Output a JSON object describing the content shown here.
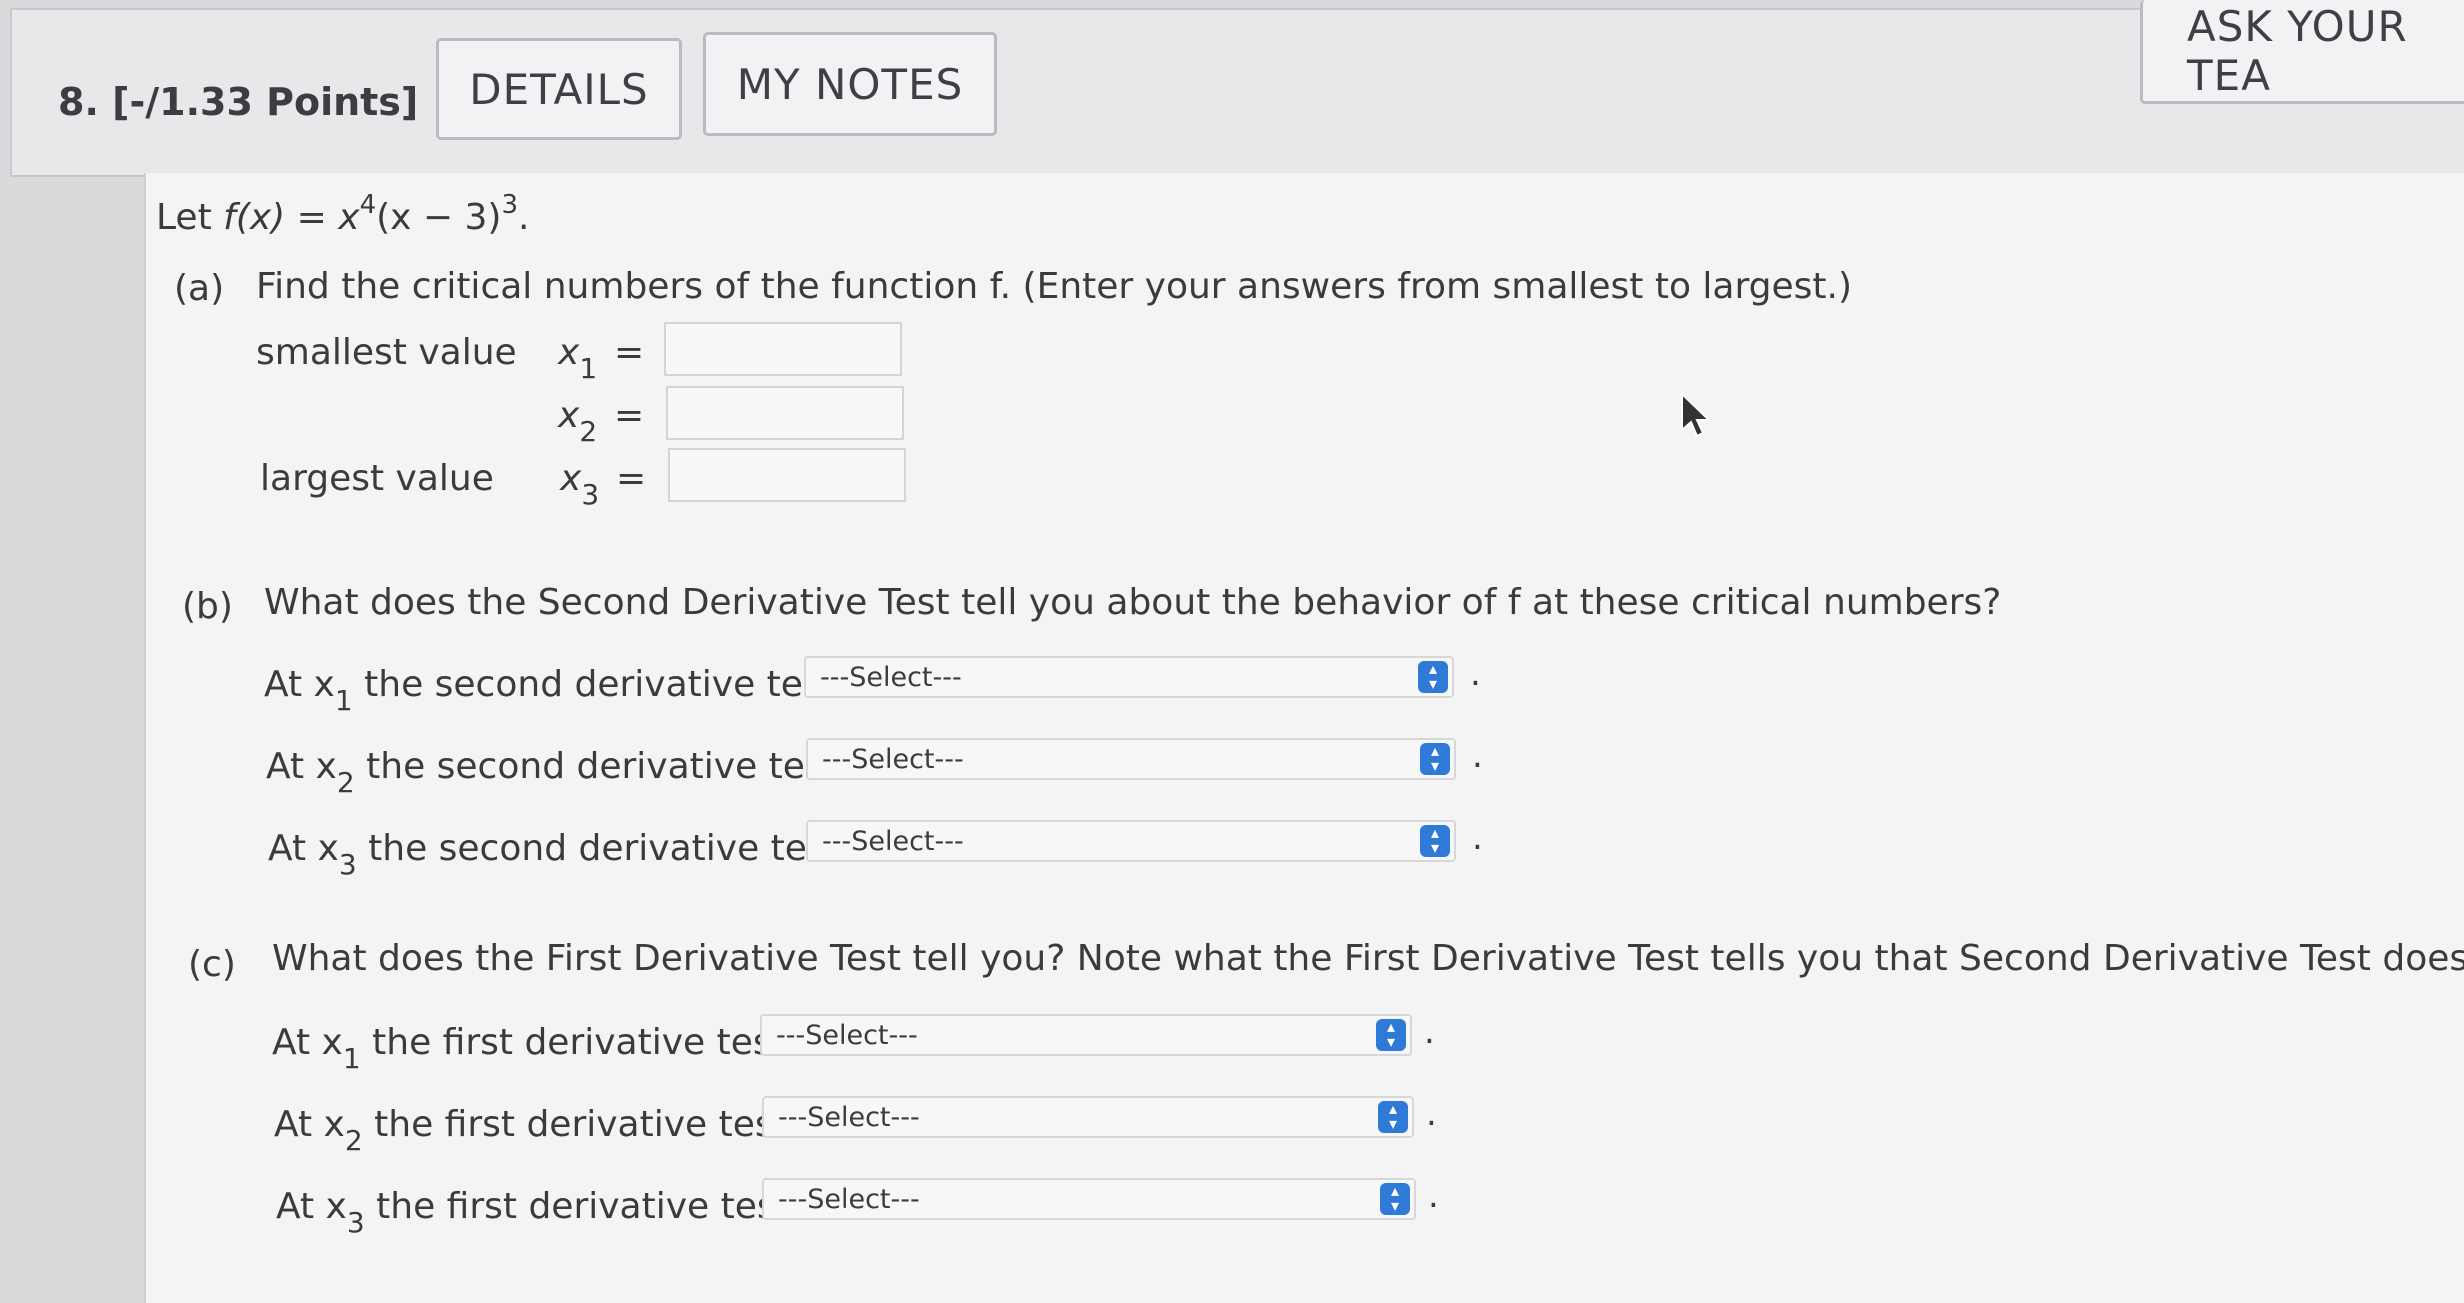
{
  "header": {
    "question_number": "8. [-/1.33 Points]",
    "details_label": "DETAILS",
    "notes_label": "MY NOTES",
    "ask_label": "ASK YOUR TEA"
  },
  "problem": {
    "intro_prefix": "Let ",
    "intro_func": "f(x) = x",
    "intro_exp1": "4",
    "intro_mid": "(x − 3)",
    "intro_exp2": "3",
    "intro_end": "."
  },
  "part_a": {
    "label": "(a)",
    "question": "Find the critical numbers of the function f. (Enter your answers from smallest to largest.)",
    "rows": [
      {
        "tag": "smallest value",
        "var": "x",
        "sub": "1",
        "eq": "=",
        "value": ""
      },
      {
        "tag": "",
        "var": "x",
        "sub": "2",
        "eq": "=",
        "value": ""
      },
      {
        "tag": "largest value",
        "var": "x",
        "sub": "3",
        "eq": "=",
        "value": ""
      }
    ]
  },
  "part_b": {
    "label": "(b)",
    "question": "What does the Second Derivative Test tell you about the behavior of f at these critical numbers?",
    "rows": [
      {
        "prefix": "At x",
        "sub": "1",
        "suffix": " the second derivative test",
        "selected": "---Select---"
      },
      {
        "prefix": "At x",
        "sub": "2",
        "suffix": " the second derivative test",
        "selected": "---Select---"
      },
      {
        "prefix": "At x",
        "sub": "3",
        "suffix": " the second derivative test",
        "selected": "---Select---"
      }
    ]
  },
  "part_c": {
    "label": "(c)",
    "question": "What does the First Derivative Test tell you? Note what the First Derivative Test tells you that Second Derivative Test does not.",
    "rows": [
      {
        "prefix": "At x",
        "sub": "1",
        "suffix": " the first derivative test",
        "selected": "---Select---"
      },
      {
        "prefix": "At x",
        "sub": "2",
        "suffix": " the first derivative test",
        "selected": "---Select---"
      },
      {
        "prefix": "At x",
        "sub": "3",
        "suffix": " the first derivative test",
        "selected": "---Select---"
      }
    ]
  },
  "period": "."
}
